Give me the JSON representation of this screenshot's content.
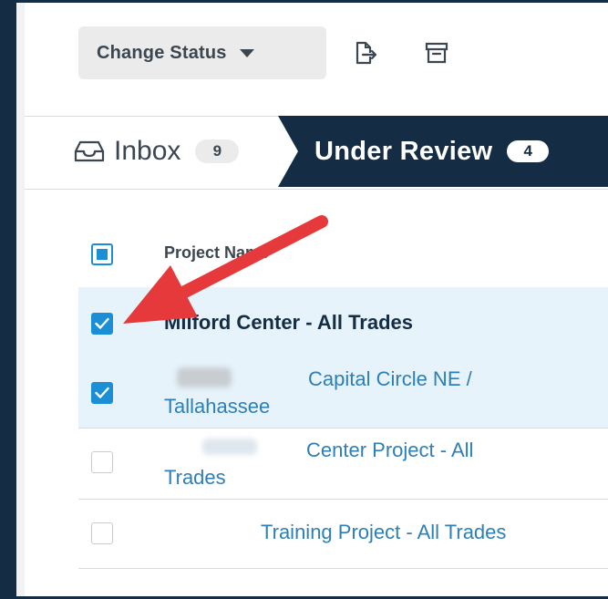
{
  "toolbar": {
    "change_status_label": "Change Status",
    "icons": [
      "caret-down-icon",
      "export-icon",
      "archive-icon"
    ]
  },
  "tabs": {
    "inbox": {
      "label": "Inbox",
      "count": "9",
      "icon": "inbox-tray-icon"
    },
    "under_review": {
      "label": "Under Review",
      "count": "4"
    }
  },
  "table": {
    "header": {
      "project_name": "Project Name"
    },
    "rows": [
      {
        "line1": "Milford Center - All Trades",
        "line2": "",
        "checked": true,
        "style": "bold"
      },
      {
        "line1": "Capital Circle NE /",
        "line2": "Tallahassee",
        "checked": true,
        "style": "link"
      },
      {
        "line1": "Center Project - All",
        "line2": "Trades",
        "checked": false,
        "style": "link"
      },
      {
        "line1": "Training Project - All Trades",
        "line2": "",
        "checked": false,
        "style": "link"
      }
    ]
  },
  "colors": {
    "accent": "#1b8fd6",
    "active_tab": "#142c44",
    "selected_row": "#e6f3fa",
    "link": "#2e7fb5",
    "annotation_arrow": "#e5393b"
  }
}
